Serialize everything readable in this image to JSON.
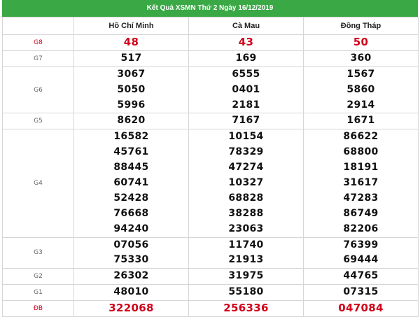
{
  "header": {
    "title": "Kết Quả XSMN Thứ 2 Ngày 16/12/2019"
  },
  "provinces": [
    "Hồ Chí Minh",
    "Cà Mau",
    "Đồng Tháp"
  ],
  "prizes": [
    {
      "label": "G8",
      "values": [
        [
          "48"
        ],
        [
          "43"
        ],
        [
          "50"
        ]
      ]
    },
    {
      "label": "G7",
      "values": [
        [
          "517"
        ],
        [
          "169"
        ],
        [
          "360"
        ]
      ]
    },
    {
      "label": "G6",
      "values": [
        [
          "3067",
          "5050",
          "5996"
        ],
        [
          "6555",
          "0401",
          "2181"
        ],
        [
          "1567",
          "5860",
          "2914"
        ]
      ]
    },
    {
      "label": "G5",
      "values": [
        [
          "8620"
        ],
        [
          "7167"
        ],
        [
          "1671"
        ]
      ]
    },
    {
      "label": "G4",
      "values": [
        [
          "16582",
          "45761",
          "88445",
          "60741",
          "52428",
          "76668",
          "94240"
        ],
        [
          "10154",
          "78329",
          "47274",
          "10327",
          "68828",
          "38288",
          "23063"
        ],
        [
          "86622",
          "68800",
          "18191",
          "31617",
          "47283",
          "86749",
          "82206"
        ]
      ]
    },
    {
      "label": "G3",
      "values": [
        [
          "07056",
          "75330"
        ],
        [
          "11740",
          "21913"
        ],
        [
          "76399",
          "69444"
        ]
      ]
    },
    {
      "label": "G2",
      "values": [
        [
          "26302"
        ],
        [
          "31975"
        ],
        [
          "44765"
        ]
      ]
    },
    {
      "label": "G1",
      "values": [
        [
          "48010"
        ],
        [
          "55180"
        ],
        [
          "07315"
        ]
      ]
    },
    {
      "label": "ĐB",
      "values": [
        [
          "322068"
        ],
        [
          "256336"
        ],
        [
          "047084"
        ]
      ]
    }
  ],
  "colors": {
    "title_bg": "#3aa845",
    "highlight": "#d0021b",
    "border": "#d6d6d6"
  }
}
